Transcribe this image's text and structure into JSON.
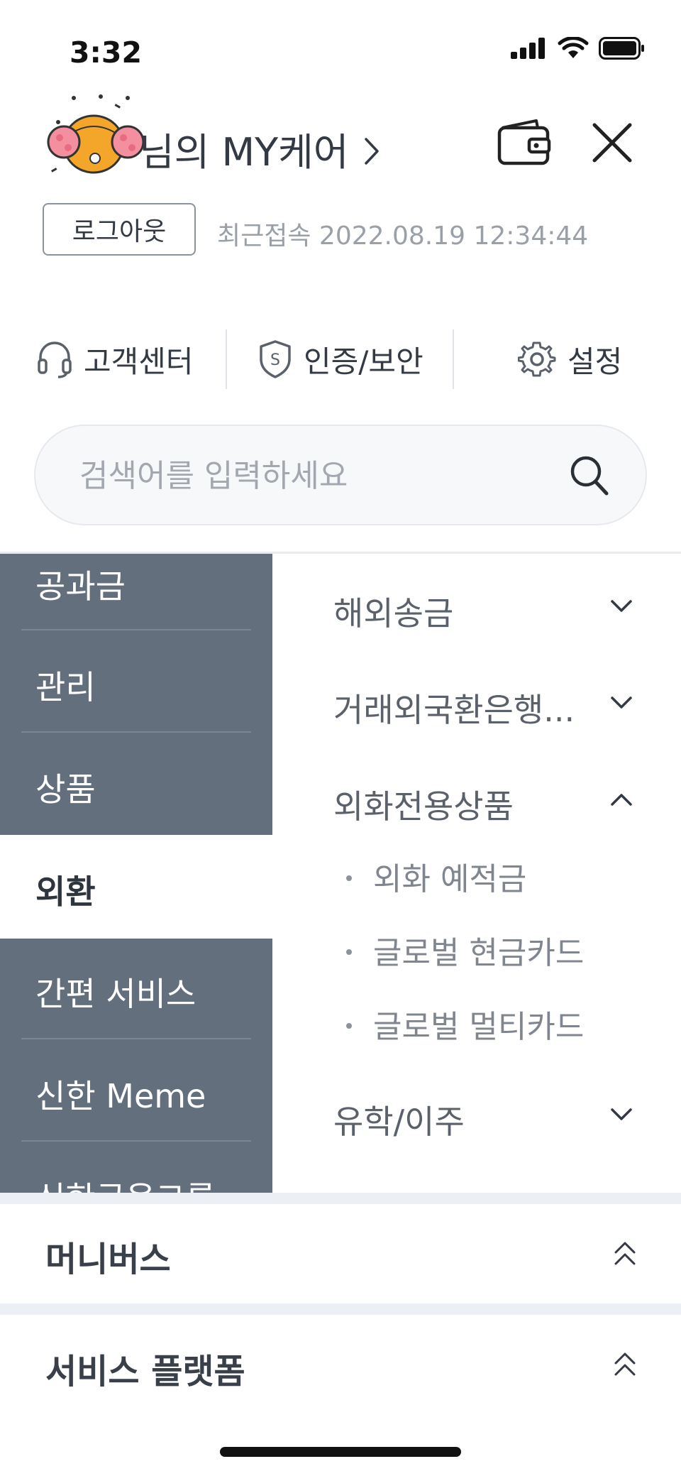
{
  "status_bar": {
    "time": "3:32"
  },
  "header": {
    "title": "님의 MY케어",
    "logout_label": "로그아웃",
    "last_login": "최근접속 2022.08.19 12:34:44"
  },
  "quick_links": [
    {
      "label": "고객센터",
      "icon": "headset-icon"
    },
    {
      "label": "인증/보안",
      "icon": "shield-icon"
    },
    {
      "label": "설정",
      "icon": "gear-icon"
    }
  ],
  "search": {
    "placeholder": "검색어를 입력하세요"
  },
  "categories": [
    {
      "label": "공과금",
      "active": false
    },
    {
      "label": "관리",
      "active": false
    },
    {
      "label": "상품",
      "active": false
    },
    {
      "label": "외환",
      "active": true
    },
    {
      "label": "간편 서비스",
      "active": false
    },
    {
      "label": "신한 Meme",
      "active": false
    },
    {
      "label": "신한금융그룹",
      "active": false
    }
  ],
  "menu": {
    "items": [
      {
        "label": "해외송금",
        "expanded": false
      },
      {
        "label": "거래외국환은행...",
        "expanded": false
      },
      {
        "label": "외화전용상품",
        "expanded": true
      },
      {
        "label": "유학/이주",
        "expanded": false
      }
    ],
    "sub_items": [
      "외화 예적금",
      "글로벌 현금카드",
      "글로벌 멀티카드"
    ]
  },
  "sections": [
    {
      "label": "머니버스"
    },
    {
      "label": "서비스 플랫폼"
    }
  ],
  "colors": {
    "category_bg": "#636f7d",
    "accent_text": "#2f353d",
    "divider": "#eceff3"
  }
}
